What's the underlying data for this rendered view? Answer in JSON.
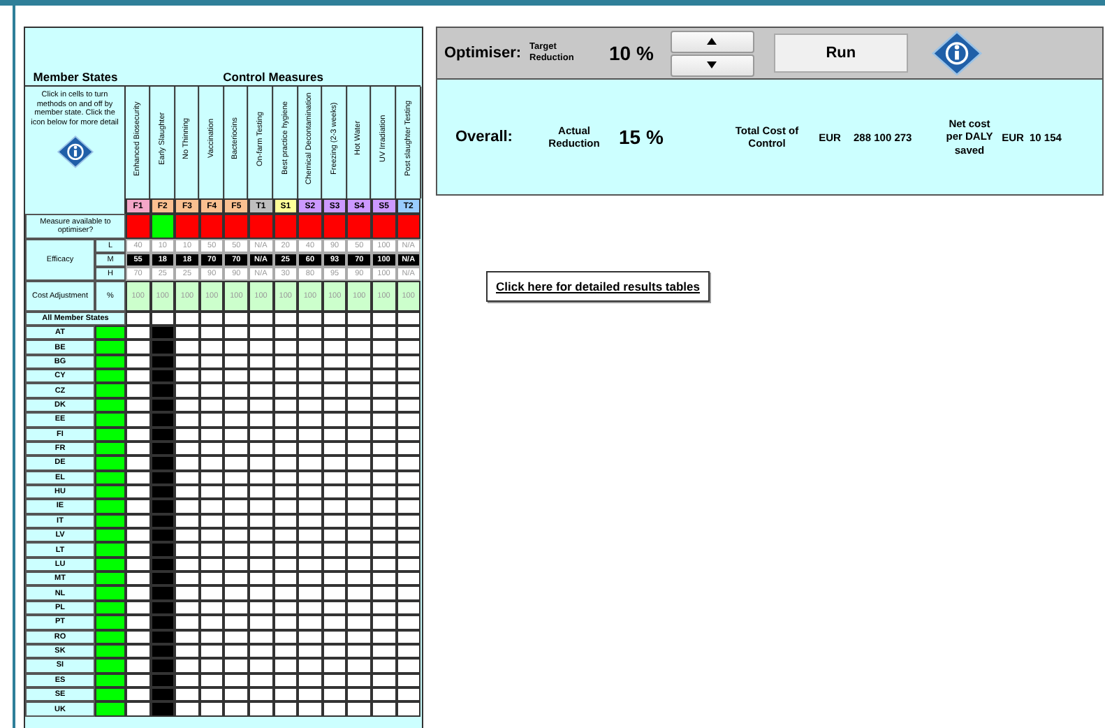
{
  "member_states_header": "Member States",
  "instructions": "Click in cells to turn methods on and off by member state. Click the icon below for more detail",
  "control_measures_header": "Control Measures",
  "available_label": "Measure available to optimiser?",
  "efficacy_label": "Efficacy",
  "efficacy_levels": [
    "L",
    "M",
    "H"
  ],
  "cost_label": "Cost Adjustment",
  "cost_unit": "%",
  "all_states_label": "All Member States",
  "measures": [
    {
      "name": "Enhanced Biosecurity",
      "code": "F1",
      "color": "#f4a6c8",
      "available": false,
      "all_states_on": false,
      "efficacy": [
        "40",
        "55",
        "70"
      ],
      "cost_adjustment": "100"
    },
    {
      "name": "Early Slaughter",
      "code": "F2",
      "color": "#fac090",
      "available": true,
      "all_states_on": false,
      "efficacy": [
        "10",
        "18",
        "25"
      ],
      "cost_adjustment": "100"
    },
    {
      "name": "No Thinning",
      "code": "F3",
      "color": "#fac090",
      "available": false,
      "all_states_on": false,
      "efficacy": [
        "10",
        "18",
        "25"
      ],
      "cost_adjustment": "100"
    },
    {
      "name": "Vaccination",
      "code": "F4",
      "color": "#fac090",
      "available": false,
      "all_states_on": false,
      "efficacy": [
        "50",
        "70",
        "90"
      ],
      "cost_adjustment": "100"
    },
    {
      "name": "Bacteriocins",
      "code": "F5",
      "color": "#fac090",
      "available": false,
      "all_states_on": false,
      "efficacy": [
        "50",
        "70",
        "90"
      ],
      "cost_adjustment": "100"
    },
    {
      "name": "On-farm Testing",
      "code": "T1",
      "color": "#bfbfbf",
      "available": false,
      "all_states_on": false,
      "efficacy": [
        "N/A",
        "N/A",
        "N/A"
      ],
      "cost_adjustment": "100"
    },
    {
      "name": "Best practice hygiene",
      "code": "S1",
      "color": "#ffff99",
      "available": false,
      "all_states_on": false,
      "efficacy": [
        "20",
        "25",
        "30"
      ],
      "cost_adjustment": "100"
    },
    {
      "name": "Chemical Decontamination",
      "code": "S2",
      "color": "#cc99ff",
      "available": false,
      "all_states_on": false,
      "efficacy": [
        "40",
        "60",
        "80"
      ],
      "cost_adjustment": "100"
    },
    {
      "name": "Freezing (2-3 weeks)",
      "code": "S3",
      "color": "#cc99ff",
      "available": false,
      "all_states_on": false,
      "efficacy": [
        "90",
        "93",
        "95"
      ],
      "cost_adjustment": "100"
    },
    {
      "name": "Hot Water",
      "code": "S4",
      "color": "#cc99ff",
      "available": false,
      "all_states_on": false,
      "efficacy": [
        "50",
        "70",
        "90"
      ],
      "cost_adjustment": "100"
    },
    {
      "name": "UV Irradiation",
      "code": "S5",
      "color": "#cc99ff",
      "available": false,
      "all_states_on": false,
      "efficacy": [
        "100",
        "100",
        "100"
      ],
      "cost_adjustment": "100"
    },
    {
      "name": "Post slaughter Testing",
      "code": "T2",
      "color": "#99ccff",
      "available": false,
      "all_states_on": false,
      "efficacy": [
        "N/A",
        "N/A",
        "N/A"
      ],
      "cost_adjustment": "100"
    }
  ],
  "member_states": [
    {
      "code": "AT",
      "active": true,
      "on": [
        false,
        true,
        false,
        false,
        false,
        false,
        false,
        false,
        false,
        false,
        false,
        false
      ]
    },
    {
      "code": "BE",
      "active": true,
      "on": [
        false,
        true,
        false,
        false,
        false,
        false,
        false,
        false,
        false,
        false,
        false,
        false
      ]
    },
    {
      "code": "BG",
      "active": true,
      "on": [
        false,
        true,
        false,
        false,
        false,
        false,
        false,
        false,
        false,
        false,
        false,
        false
      ]
    },
    {
      "code": "CY",
      "active": true,
      "on": [
        false,
        true,
        false,
        false,
        false,
        false,
        false,
        false,
        false,
        false,
        false,
        false
      ]
    },
    {
      "code": "CZ",
      "active": true,
      "on": [
        false,
        true,
        false,
        false,
        false,
        false,
        false,
        false,
        false,
        false,
        false,
        false
      ]
    },
    {
      "code": "DK",
      "active": true,
      "on": [
        false,
        true,
        false,
        false,
        false,
        false,
        false,
        false,
        false,
        false,
        false,
        false
      ]
    },
    {
      "code": "EE",
      "active": true,
      "on": [
        false,
        true,
        false,
        false,
        false,
        false,
        false,
        false,
        false,
        false,
        false,
        false
      ]
    },
    {
      "code": "FI",
      "active": true,
      "on": [
        false,
        true,
        false,
        false,
        false,
        false,
        false,
        false,
        false,
        false,
        false,
        false
      ]
    },
    {
      "code": "FR",
      "active": true,
      "on": [
        false,
        true,
        false,
        false,
        false,
        false,
        false,
        false,
        false,
        false,
        false,
        false
      ]
    },
    {
      "code": "DE",
      "active": true,
      "on": [
        false,
        true,
        false,
        false,
        false,
        false,
        false,
        false,
        false,
        false,
        false,
        false
      ]
    },
    {
      "code": "EL",
      "active": true,
      "on": [
        false,
        true,
        false,
        false,
        false,
        false,
        false,
        false,
        false,
        false,
        false,
        false
      ]
    },
    {
      "code": "HU",
      "active": true,
      "on": [
        false,
        true,
        false,
        false,
        false,
        false,
        false,
        false,
        false,
        false,
        false,
        false
      ]
    },
    {
      "code": "IE",
      "active": true,
      "on": [
        false,
        true,
        false,
        false,
        false,
        false,
        false,
        false,
        false,
        false,
        false,
        false
      ]
    },
    {
      "code": "IT",
      "active": true,
      "on": [
        false,
        true,
        false,
        false,
        false,
        false,
        false,
        false,
        false,
        false,
        false,
        false
      ]
    },
    {
      "code": "LV",
      "active": true,
      "on": [
        false,
        true,
        false,
        false,
        false,
        false,
        false,
        false,
        false,
        false,
        false,
        false
      ]
    },
    {
      "code": "LT",
      "active": true,
      "on": [
        false,
        true,
        false,
        false,
        false,
        false,
        false,
        false,
        false,
        false,
        false,
        false
      ]
    },
    {
      "code": "LU",
      "active": true,
      "on": [
        false,
        true,
        false,
        false,
        false,
        false,
        false,
        false,
        false,
        false,
        false,
        false
      ]
    },
    {
      "code": "MT",
      "active": true,
      "on": [
        false,
        true,
        false,
        false,
        false,
        false,
        false,
        false,
        false,
        false,
        false,
        false
      ]
    },
    {
      "code": "NL",
      "active": true,
      "on": [
        false,
        true,
        false,
        false,
        false,
        false,
        false,
        false,
        false,
        false,
        false,
        false
      ]
    },
    {
      "code": "PL",
      "active": true,
      "on": [
        false,
        true,
        false,
        false,
        false,
        false,
        false,
        false,
        false,
        false,
        false,
        false
      ]
    },
    {
      "code": "PT",
      "active": true,
      "on": [
        false,
        true,
        false,
        false,
        false,
        false,
        false,
        false,
        false,
        false,
        false,
        false
      ]
    },
    {
      "code": "RO",
      "active": true,
      "on": [
        false,
        true,
        false,
        false,
        false,
        false,
        false,
        false,
        false,
        false,
        false,
        false
      ]
    },
    {
      "code": "SK",
      "active": true,
      "on": [
        false,
        true,
        false,
        false,
        false,
        false,
        false,
        false,
        false,
        false,
        false,
        false
      ]
    },
    {
      "code": "SI",
      "active": true,
      "on": [
        false,
        true,
        false,
        false,
        false,
        false,
        false,
        false,
        false,
        false,
        false,
        false
      ]
    },
    {
      "code": "ES",
      "active": true,
      "on": [
        false,
        true,
        false,
        false,
        false,
        false,
        false,
        false,
        false,
        false,
        false,
        false
      ]
    },
    {
      "code": "SE",
      "active": true,
      "on": [
        false,
        true,
        false,
        false,
        false,
        false,
        false,
        false,
        false,
        false,
        false,
        false
      ]
    },
    {
      "code": "UK",
      "active": true,
      "on": [
        false,
        true,
        false,
        false,
        false,
        false,
        false,
        false,
        false,
        false,
        false,
        false
      ]
    }
  ],
  "optimiser": {
    "label": "Optimiser:",
    "target_label": "Target Reduction",
    "target_value": "10 %",
    "run_button": "Run"
  },
  "overall": {
    "label": "Overall:",
    "actual_label": "Actual Reduction",
    "actual_value": "15 %",
    "total_cost_label": "Total Cost of Control",
    "total_cost_currency": "EUR",
    "total_cost_value": "288 100 273",
    "net_cost_label": "Net cost per DALY saved",
    "net_cost_currency": "EUR",
    "net_cost_value": "10 154"
  },
  "results_link": "Click here for detailed results tables"
}
